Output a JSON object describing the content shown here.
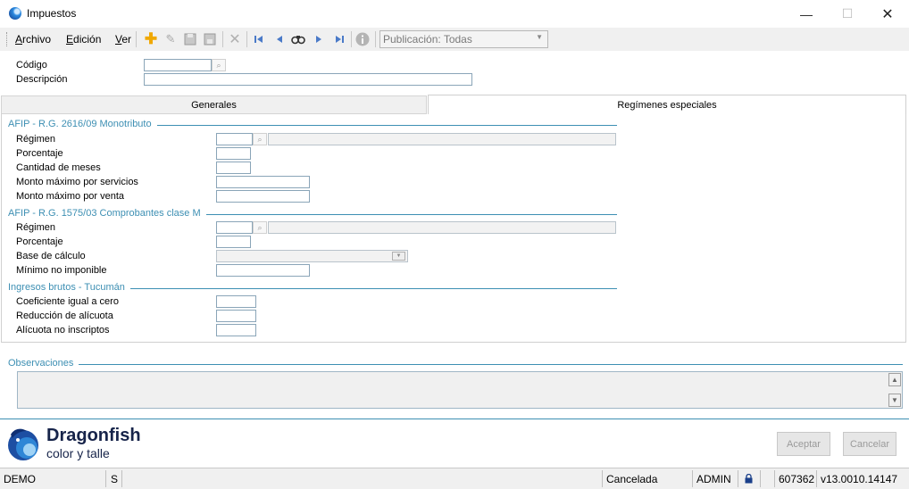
{
  "window": {
    "title": "Impuestos",
    "minimize": "—",
    "maximize": "☐",
    "close": "✕"
  },
  "menu": {
    "archivo_first": "A",
    "archivo_rest": "rchivo",
    "edicion_first": "E",
    "edicion_rest": "dición",
    "ver_first": "V",
    "ver_rest": "er"
  },
  "toolbar": {
    "publicacion": "Publicación: Todas"
  },
  "form": {
    "codigo_label": "Código",
    "descripcion_label": "Descripción"
  },
  "tabs": {
    "generales": "Generales",
    "especiales": "Regímenes especiales"
  },
  "sections": {
    "monotributo": {
      "title": "AFIP - R.G. 2616/09 Monotributo",
      "regimen": "Régimen",
      "porcentaje": "Porcentaje",
      "cantidad_meses": "Cantidad de meses",
      "monto_servicios": "Monto máximo por servicios",
      "monto_venta": "Monto máximo por venta"
    },
    "clase_m": {
      "title": "AFIP - R.G. 1575/03 Comprobantes clase M",
      "regimen": "Régimen",
      "porcentaje": "Porcentaje",
      "base_calculo": "Base de cálculo",
      "minimo": "Mínimo no imponible"
    },
    "tucuman": {
      "title": "Ingresos brutos - Tucumán",
      "coeficiente": "Coeficiente igual a cero",
      "reduccion": "Reducción de alícuota",
      "alicuota": "Alícuota no inscriptos"
    },
    "observaciones": {
      "title": "Observaciones"
    }
  },
  "brand": {
    "name": "Dragonfish",
    "tagline": "color y talle"
  },
  "buttons": {
    "aceptar": "Aceptar",
    "cancelar": "Cancelar"
  },
  "status": {
    "db": "DEMO",
    "s": "S",
    "estado": "Cancelada",
    "user": "ADMIN",
    "number": "607362",
    "version": "v13.0010.14147"
  },
  "colors": {
    "accent": "#3d8fb3",
    "toolbar_bg": "#f0f0f0"
  }
}
